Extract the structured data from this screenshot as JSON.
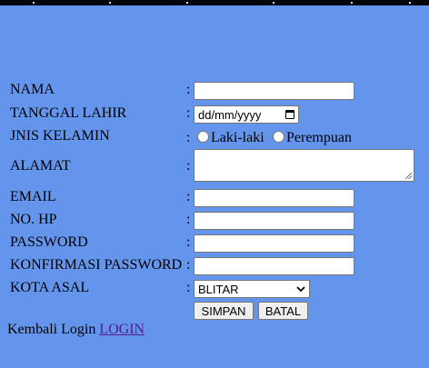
{
  "form": {
    "nama_label": "NAMA",
    "tanggal_label": "TANGGAL LAHIR",
    "date_placeholder": "dd/mm/yyyy",
    "jenis_label": "JNIS KELAMIN",
    "gender_options": [
      "Laki-laki",
      "Perempuan"
    ],
    "alamat_label": "ALAMAT",
    "email_label": "EMAIL",
    "hp_label": "NO. HP",
    "password_label": "PASSWORD",
    "konfirmasi_label": "KONFIRMASI PASSWORD",
    "kota_label": "KOTA ASAL",
    "kota_selected": "BLITAR",
    "separator": ":"
  },
  "buttons": {
    "save": "SIMPAN",
    "cancel": "BATAL"
  },
  "footer": {
    "text": "Kembali Login",
    "link": "LOGIN"
  },
  "colors": {
    "background": "#6495ed",
    "link": "#551a8b"
  },
  "icons": {
    "date": "calendar-icon",
    "select": "chevron-down-icon",
    "textarea": "resize-grip-icon"
  }
}
